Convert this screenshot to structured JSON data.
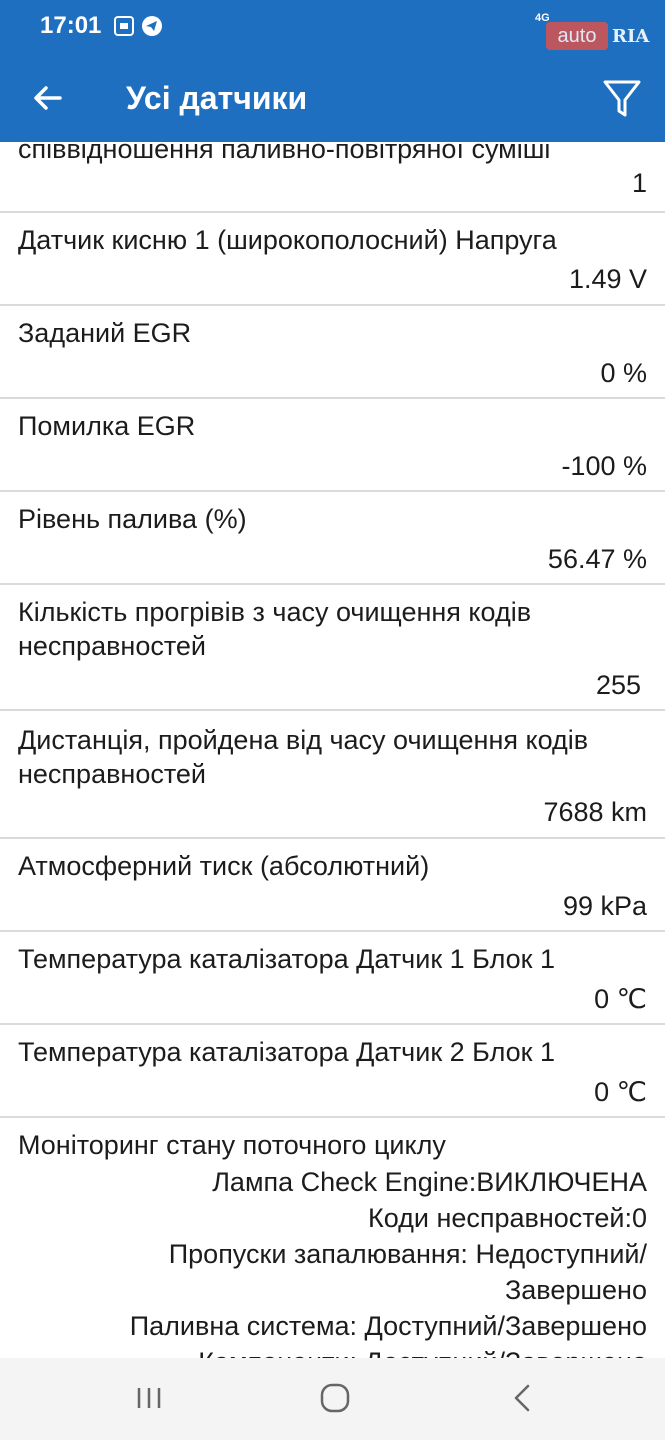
{
  "status_bar": {
    "time": "17:01",
    "network": "4G"
  },
  "watermark": {
    "auto": "auto",
    "ria": "RIA"
  },
  "header": {
    "title": "Усі датчики",
    "back_icon": "arrow-left-icon",
    "filter_icon": "filter-icon"
  },
  "sensors": [
    {
      "name": "співвідношення паливно-повітряної суміші",
      "value": "1"
    },
    {
      "name": "Датчик кисню 1 (широкополосний) Напруга",
      "value": "1.49 V"
    },
    {
      "name": "Заданий EGR",
      "value": "0 %"
    },
    {
      "name": "Помилка EGR",
      "value": "-100 %"
    },
    {
      "name": "Рівень палива (%)",
      "value": "56.47 %"
    },
    {
      "name": "Кількість прогрівів з часу очищення кодів несправностей",
      "value": "255"
    },
    {
      "name": "Дистанція, пройдена від часу очищення кодів несправностей",
      "value": "7688 km"
    },
    {
      "name": "Атмосферний тиск (абсолютний)",
      "value": "99 kPa"
    },
    {
      "name": "Температура каталізатора Датчик 1 Блок 1",
      "value": "0 ℃"
    },
    {
      "name": "Температура каталізатора Датчик 2 Блок 1",
      "value": "0 ℃"
    }
  ],
  "monitoring": {
    "name": "Моніторинг стану поточного циклу",
    "lines": [
      "Лампа Check Engine:ВИКЛЮЧЕНА",
      "Коди несправностей:0",
      "Пропуски запалювання: Недоступний/",
      "Завершено",
      "Паливна система: Доступний/Завершено",
      "Компоненти: Доступний/Завершено"
    ]
  },
  "nav_bar": {
    "recent_icon": "recent-apps-icon",
    "home_icon": "home-icon",
    "back_icon": "back-chevron-icon"
  }
}
